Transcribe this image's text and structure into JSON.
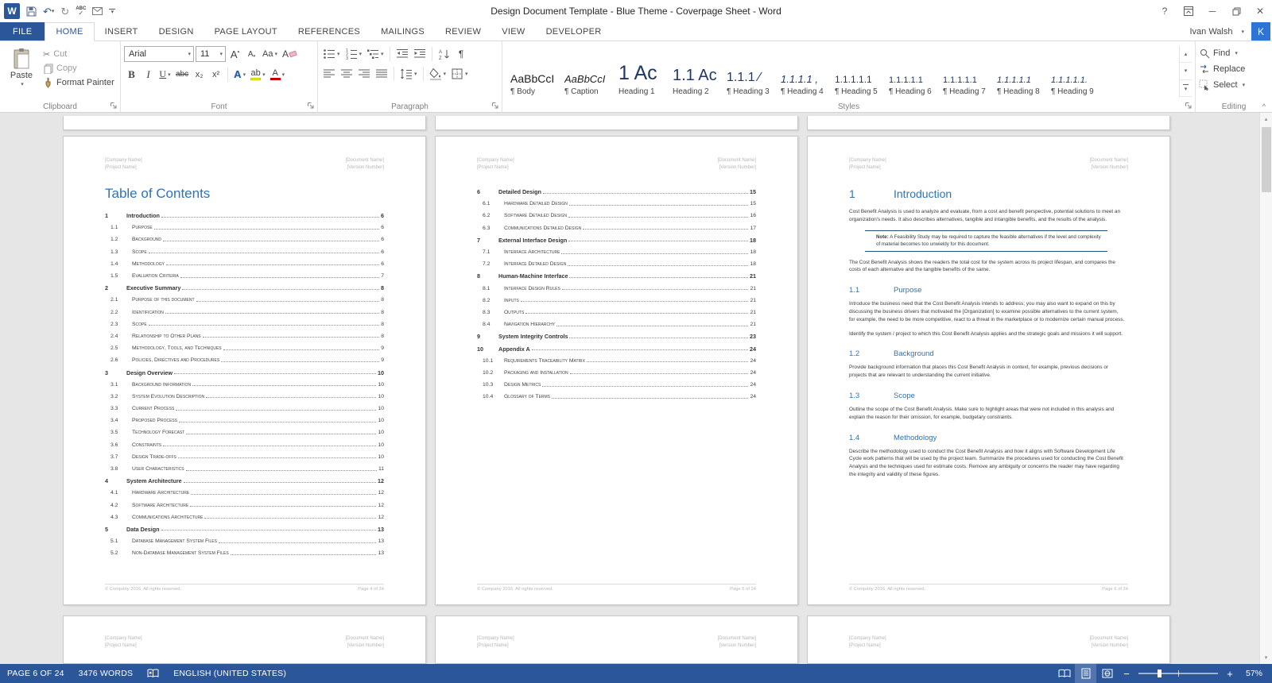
{
  "colors": {
    "accent": "#2b579a",
    "heading_blue": "#2e74b5",
    "note_border": "#1f4e79",
    "highlight_yellow": "#ffff00",
    "font_color_red": "#c00000",
    "avatar_blue": "#2e74d6"
  },
  "icons": {
    "dropdown": "▾",
    "scroll_up": "▴",
    "scroll_down": "▾",
    "pilcrow": "¶",
    "cut": "✂",
    "undo": "↶",
    "redo": "↻",
    "help": "?",
    "minimize": "─",
    "close": "✕",
    "collapse_ribbon": "^",
    "zoom_out": "−",
    "zoom_in": "+",
    "app_initial": "W"
  },
  "titlebar": {
    "title": "Design Document Template - Blue Theme - Coverpage Sheet - Word"
  },
  "account": {
    "name": "Ivan Walsh",
    "avatar_initial": "K"
  },
  "tabs": [
    {
      "label": "FILE",
      "file": true
    },
    {
      "label": "HOME",
      "active": true
    },
    {
      "label": "INSERT"
    },
    {
      "label": "DESIGN"
    },
    {
      "label": "PAGE LAYOUT"
    },
    {
      "label": "REFERENCES"
    },
    {
      "label": "MAILINGS"
    },
    {
      "label": "REVIEW"
    },
    {
      "label": "VIEW"
    },
    {
      "label": "DEVELOPER"
    }
  ],
  "ribbon": {
    "clipboard": {
      "group_label": "Clipboard",
      "paste": "Paste",
      "cut": "Cut",
      "copy": "Copy",
      "format_painter": "Format Painter"
    },
    "font": {
      "group_label": "Font",
      "font_name": "Arial",
      "font_size": "11",
      "grow": "A",
      "shrink": "A",
      "change_case": "Aa",
      "clear": "A",
      "bold": "B",
      "italic": "I",
      "underline": "U",
      "strikethrough": "abc",
      "subscript": "x₂",
      "superscript": "x²",
      "effects": "A",
      "highlight": "ab",
      "color": "A"
    },
    "paragraph": {
      "group_label": "Paragraph"
    },
    "styles": {
      "group_label": "Styles",
      "items": [
        {
          "preview": "AaBbCcI",
          "label": "¶ Body",
          "cls": "p-body"
        },
        {
          "preview": "AaBbCcI",
          "label": "¶ Caption",
          "cls": "p-caption"
        },
        {
          "preview": "1 Ac",
          "label": "Heading 1",
          "cls": "p-h1"
        },
        {
          "preview": "1.1 Ac",
          "label": "Heading 2",
          "cls": "p-h2"
        },
        {
          "preview": "1.1.1 ⁄",
          "label": "¶ Heading 3",
          "cls": "p-h3"
        },
        {
          "preview": "1.1.1.1 ,",
          "label": "¶ Heading 4",
          "cls": "p-h4"
        },
        {
          "preview": "1.1.1.1.1",
          "label": "¶ Heading 5",
          "cls": "p-h5"
        },
        {
          "preview": "1.1.1.1.1",
          "label": "¶ Heading 6",
          "cls": "p-h6"
        },
        {
          "preview": "1.1.1.1.1",
          "label": "¶ Heading 7",
          "cls": "p-h7"
        },
        {
          "preview": "1.1.1.1.1",
          "label": "¶ Heading 8",
          "cls": "p-h8"
        },
        {
          "preview": "1.1.1.1.1.",
          "label": "¶ Heading 9",
          "cls": "p-h9"
        }
      ]
    },
    "editing": {
      "group_label": "Editing",
      "find": "Find",
      "replace": "Replace",
      "select": "Select"
    }
  },
  "document": {
    "header": {
      "company": "[Company Name]",
      "project": "[Project Name]",
      "doc_name": "[Document Name]",
      "version": "[Version Number]"
    },
    "footer_copyright": "© Company 2016. All rights reserved.",
    "page_footers": [
      "Page 4 of 24",
      "Page 5 of 24",
      "Page 6 of 24"
    ],
    "toc_title": "Table of Contents",
    "toc_page1": [
      {
        "n": "1",
        "t": "Introduction",
        "p": "6",
        "lvl": 1
      },
      {
        "n": "1.1",
        "t": "Purpose",
        "p": "6",
        "lvl": 2
      },
      {
        "n": "1.2",
        "t": "Background",
        "p": "6",
        "lvl": 2
      },
      {
        "n": "1.3",
        "t": "Scope",
        "p": "6",
        "lvl": 2
      },
      {
        "n": "1.4",
        "t": "Methodology",
        "p": "6",
        "lvl": 2
      },
      {
        "n": "1.5",
        "t": "Evaluation Criteria",
        "p": "7",
        "lvl": 2
      },
      {
        "n": "2",
        "t": "Executive Summary",
        "p": "8",
        "lvl": 1
      },
      {
        "n": "2.1",
        "t": "Purpose of this document",
        "p": "8",
        "lvl": 2
      },
      {
        "n": "2.2",
        "t": "Identification",
        "p": "8",
        "lvl": 2
      },
      {
        "n": "2.3",
        "t": "Scope",
        "p": "8",
        "lvl": 2
      },
      {
        "n": "2.4",
        "t": "Relationship to Other Plans",
        "p": "8",
        "lvl": 2
      },
      {
        "n": "2.5",
        "t": "Methodology, Tools, and Techniques",
        "p": "9",
        "lvl": 2
      },
      {
        "n": "2.6",
        "t": "Policies, Directives and Procedures",
        "p": "9",
        "lvl": 2
      },
      {
        "n": "3",
        "t": "Design Overview",
        "p": "10",
        "lvl": 1
      },
      {
        "n": "3.1",
        "t": "Background Information",
        "p": "10",
        "lvl": 2
      },
      {
        "n": "3.2",
        "t": "System Evolution Description",
        "p": "10",
        "lvl": 2
      },
      {
        "n": "3.3",
        "t": "Current Process",
        "p": "10",
        "lvl": 2
      },
      {
        "n": "3.4",
        "t": "Proposed Process",
        "p": "10",
        "lvl": 2
      },
      {
        "n": "3.5",
        "t": "Technology Forecast",
        "p": "10",
        "lvl": 2
      },
      {
        "n": "3.6",
        "t": "Constraints",
        "p": "10",
        "lvl": 2
      },
      {
        "n": "3.7",
        "t": "Design Trade-offs",
        "p": "10",
        "lvl": 2
      },
      {
        "n": "3.8",
        "t": "User Characteristics",
        "p": "11",
        "lvl": 2
      },
      {
        "n": "4",
        "t": "System Architecture",
        "p": "12",
        "lvl": 1
      },
      {
        "n": "4.1",
        "t": "Hardware Architecture",
        "p": "12",
        "lvl": 2
      },
      {
        "n": "4.2",
        "t": "Software Architecture",
        "p": "12",
        "lvl": 2
      },
      {
        "n": "4.3",
        "t": "Communications Architecture",
        "p": "12",
        "lvl": 2
      },
      {
        "n": "5",
        "t": "Data Design",
        "p": "13",
        "lvl": 1
      },
      {
        "n": "5.1",
        "t": "Database Management System Files",
        "p": "13",
        "lvl": 2
      },
      {
        "n": "5.2",
        "t": "Non-Database Management System Files",
        "p": "13",
        "lvl": 2
      }
    ],
    "toc_page2": [
      {
        "n": "6",
        "t": "Detailed Design",
        "p": "15",
        "lvl": 1
      },
      {
        "n": "6.1",
        "t": "Hardware Detailed Design",
        "p": "15",
        "lvl": 2
      },
      {
        "n": "6.2",
        "t": "Software Detailed Design",
        "p": "16",
        "lvl": 2
      },
      {
        "n": "6.3",
        "t": "Communications Detailed Design",
        "p": "17",
        "lvl": 2
      },
      {
        "n": "7",
        "t": "External Interface Design",
        "p": "18",
        "lvl": 1
      },
      {
        "n": "7.1",
        "t": "Interface Architecture",
        "p": "18",
        "lvl": 2
      },
      {
        "n": "7.2",
        "t": "Interface Detailed Design",
        "p": "18",
        "lvl": 2
      },
      {
        "n": "8",
        "t": "Human-Machine Interface",
        "p": "21",
        "lvl": 1
      },
      {
        "n": "8.1",
        "t": "Interface Design Rules",
        "p": "21",
        "lvl": 2
      },
      {
        "n": "8.2",
        "t": "Inputs",
        "p": "21",
        "lvl": 2
      },
      {
        "n": "8.3",
        "t": "Outputs",
        "p": "21",
        "lvl": 2
      },
      {
        "n": "8.4",
        "t": "Navigation Hierarchy",
        "p": "21",
        "lvl": 2
      },
      {
        "n": "9",
        "t": "System Integrity Controls",
        "p": "23",
        "lvl": 1
      },
      {
        "n": "10",
        "t": "Appendix A",
        "p": "24",
        "lvl": 1
      },
      {
        "n": "10.1",
        "t": "Requirements Traceability Matrix",
        "p": "24",
        "lvl": 2
      },
      {
        "n": "10.2",
        "t": "Packaging and Installation",
        "p": "24",
        "lvl": 2
      },
      {
        "n": "10.3",
        "t": "Design Metrics",
        "p": "24",
        "lvl": 2
      },
      {
        "n": "10.4",
        "t": "Glossary of Terms",
        "p": "24",
        "lvl": 2
      }
    ],
    "intro": {
      "h1_num": "1",
      "h1_title": "Introduction",
      "p1": "Cost Benefit Analysis is used to analyze and evaluate, from a cost and benefit perspective, potential solutions to meet an organization's needs. It also describes alternatives, tangible and intangible benefits, and the results of the analysis.",
      "note_label": "Note:",
      "note_text": " A Feasibility Study may be required to capture the feasible alternatives if the level and complexity of material becomes too unwieldy for this document.",
      "p2": "The Cost Benefit Analysis shows the readers the total cost for the system across its project lifespan, and compares the costs of each alternative and the tangible benefits of the same.",
      "sections": [
        {
          "num": "1.1",
          "title": "Purpose",
          "paras": [
            "Introduce the business need that the Cost Benefit Analysis intends to address; you may also want to expand on this by discussing the business drivers that motivated the [Organization] to examine possible alternatives to the current system, for example, the need to be more competitive, react to a threat in the marketplace or to modernize certain manual process.",
            "Identify the system / project to which this Cost Benefit Analysis applies and the strategic goals and missions it will support."
          ]
        },
        {
          "num": "1.2",
          "title": "Background",
          "paras": [
            "Provide background information that places this Cost Benefit Analysis in context, for example, previous decisions or projects that are relevant to understanding the current initiative."
          ]
        },
        {
          "num": "1.3",
          "title": "Scope",
          "paras": [
            "Outline the scope of the Cost Benefit Anal­ysis. Make sure to highlight areas that were not included in this analysis and explain the reason for their omission, for example, budgetary constraints."
          ]
        },
        {
          "num": "1.4",
          "title": "Methodology",
          "paras": [
            "Describe the methodology used to conduct the Cost Benefit Analysis and how it aligns with Software Development Life Cycle work patterns that will be used by the project team. Summarize the procedures used for conducting the Cost Benefit Analysis and the techniques used for estimate costs. Remove any ambiguity or concerns the reader may have regarding the integrity and validity of these figures."
          ]
        }
      ]
    }
  },
  "statusbar": {
    "page": "PAGE 6 OF 24",
    "words": "3476 WORDS",
    "language": "ENGLISH (UNITED STATES)",
    "zoom": "57%"
  }
}
